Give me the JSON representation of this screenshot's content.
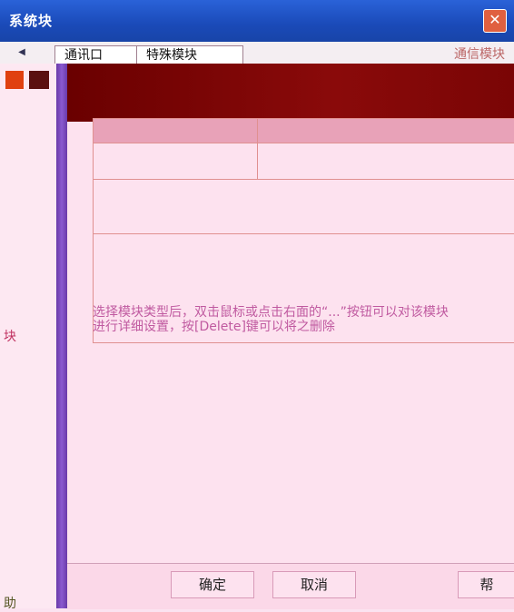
{
  "window": {
    "title": "系统块",
    "close_glyph": "✕"
  },
  "tabs": [
    "通讯口",
    "特殊模块",
    "通信模块"
  ],
  "left": {
    "label_mid": "块",
    "label_bottom": "助"
  },
  "hint": {
    "line1": "选择模块类型后，双击鼠标或点击右面的“...”按钮可以对该模块",
    "line2": "进行详细设置，按[Delete]键可以将之删除"
  },
  "buttons": {
    "ok": "确定",
    "cancel": "取消",
    "help": "帮"
  }
}
